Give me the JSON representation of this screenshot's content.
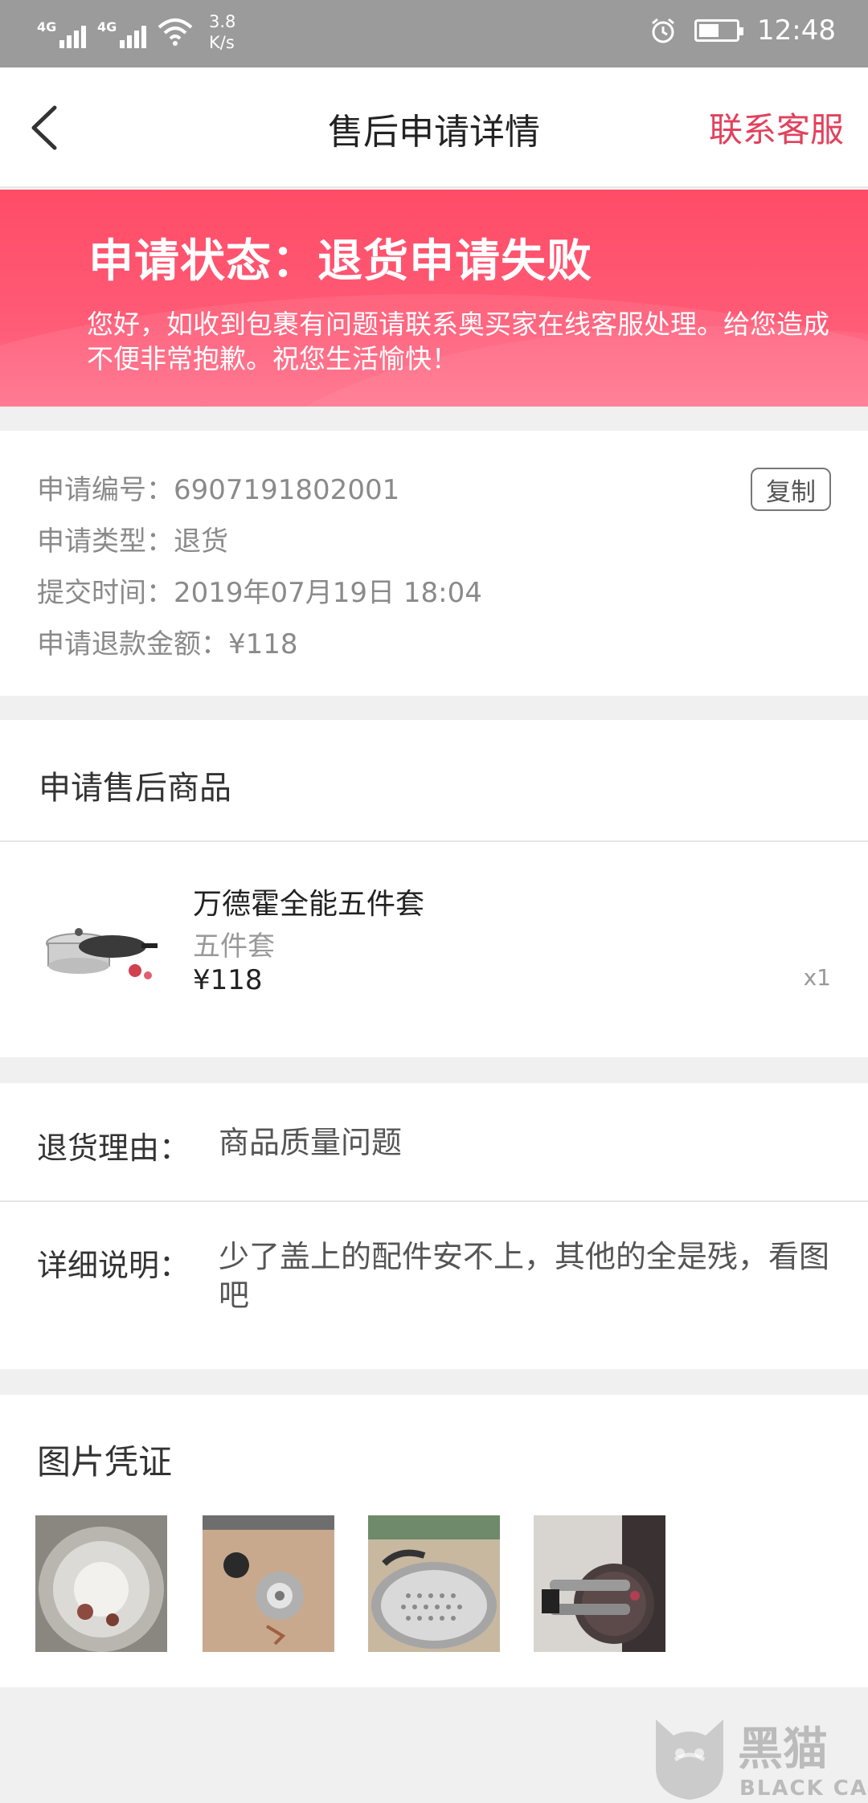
{
  "status_bar": {
    "network_1": "4G",
    "network_2": "4G",
    "speed_value": "3.8",
    "speed_unit": "K/s",
    "time": "12:48"
  },
  "nav": {
    "title": "售后申请详情",
    "service_link": "联系客服"
  },
  "banner": {
    "status": "申请状态：退货申请失败",
    "message": "您好，如收到包裹有问题请联系奥买家在线客服处理。给您造成不便非常抱歉。祝您生活愉快！"
  },
  "info": {
    "number": "申请编号：6907191802001",
    "type": "申请类型：退货",
    "submit_time": "提交时间：2019年07月19日  18:04",
    "refund_amount": "申请退款金额：¥118",
    "copy_label": "复制"
  },
  "goods": {
    "header": "申请售后商品",
    "name": "万德霍全能五件套",
    "spec": "五件套",
    "price": "¥118",
    "quantity": "x1"
  },
  "reason": {
    "label": "退货理由：",
    "value": "商品质量问题",
    "detail_label": "详细说明：",
    "detail_value": "少了盖上的配件安不上，其他的全是残，看图吧"
  },
  "evidence": {
    "header": "图片凭证"
  },
  "colors": {
    "accent": "#e2415c",
    "banner": "#ff4c67"
  }
}
